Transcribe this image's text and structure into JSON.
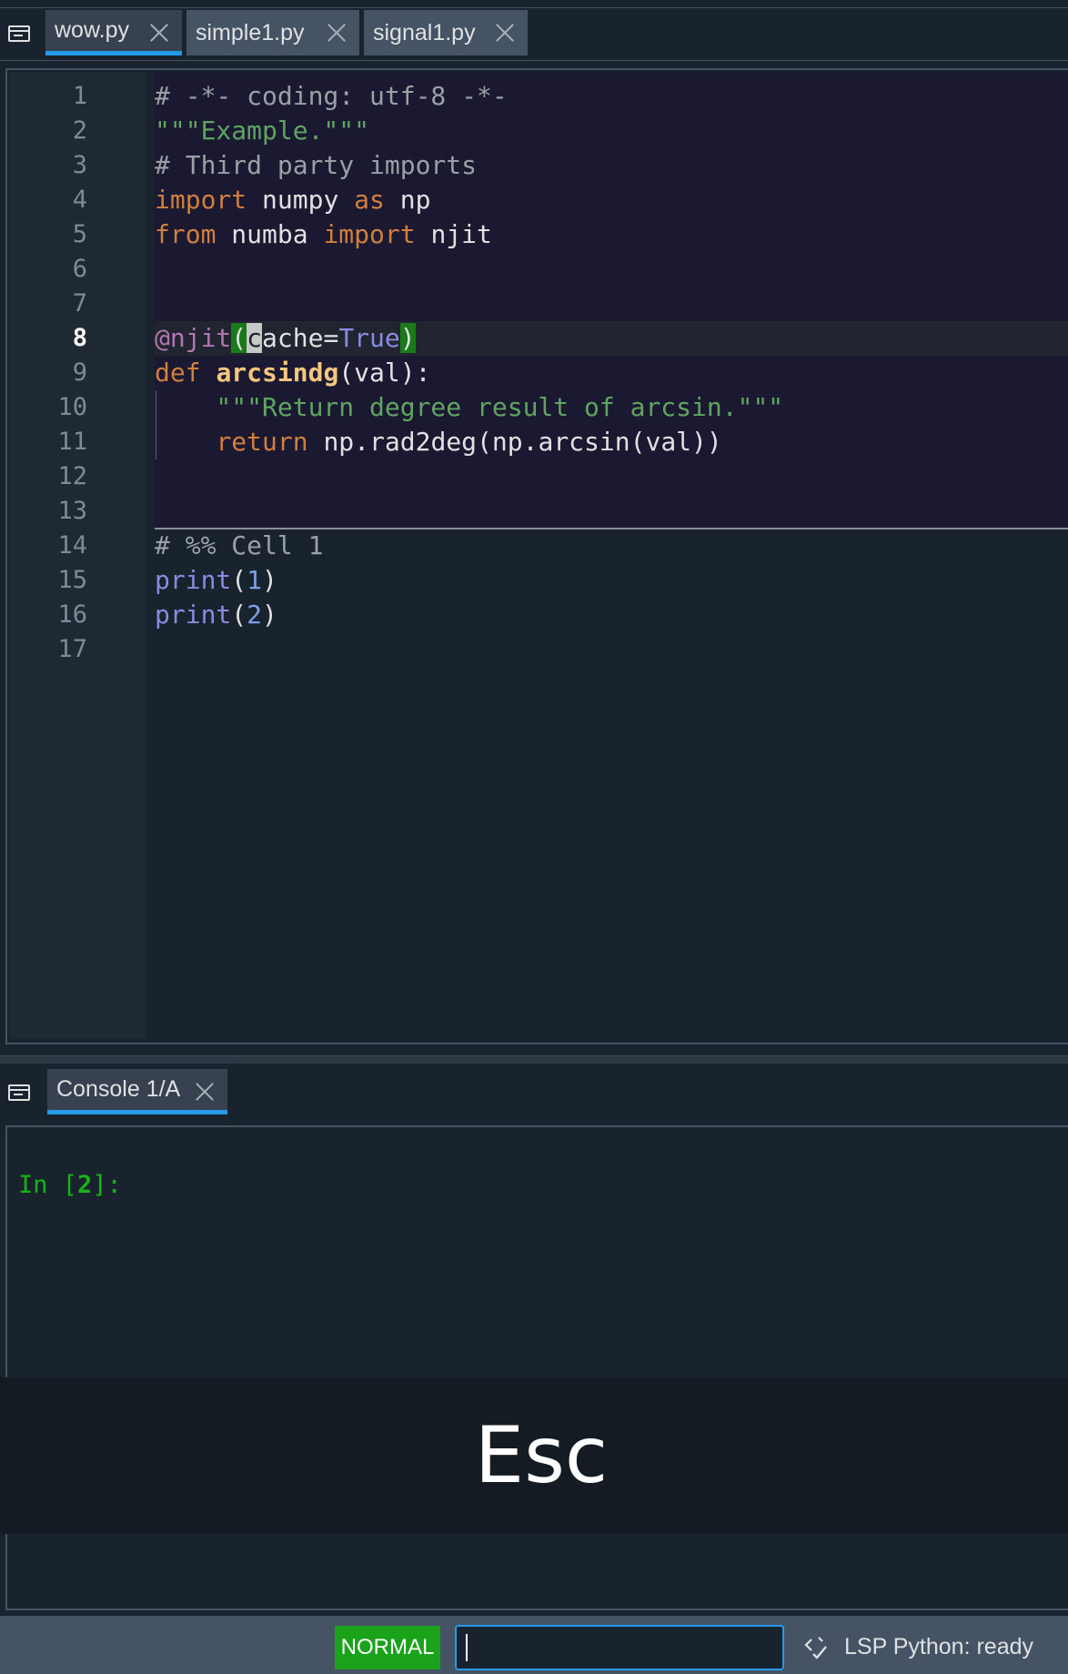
{
  "editor": {
    "tabs": [
      {
        "label": "wow.py",
        "active": true
      },
      {
        "label": "simple1.py",
        "active": false
      },
      {
        "label": "signal1.py",
        "active": false
      }
    ],
    "current_line": 8,
    "line_numbers": [
      "1",
      "2",
      "3",
      "4",
      "5",
      "6",
      "7",
      "8",
      "9",
      "10",
      "11",
      "12",
      "13",
      "14",
      "15",
      "16",
      "17"
    ],
    "code": {
      "l1": "# -*- coding: utf-8 -*-",
      "l2": "\"\"\"Example.\"\"\"",
      "l3": "# Third party imports",
      "l4_kw1": "import",
      "l4_mod": " numpy ",
      "l4_kw2": "as",
      "l4_alias": " np",
      "l5_kw1": "from",
      "l5_mod": " numba ",
      "l5_kw2": "import",
      "l5_name": " njit",
      "l8_dec": "@njit",
      "l8_open": "(",
      "l8_cursor": "c",
      "l8_arg": "ache=",
      "l8_val": "True",
      "l8_close": ")",
      "l9_kw": "def",
      "l9_fn": "arcsindg",
      "l9_sig": "(val):",
      "l10": "    \"\"\"Return degree result of arcsin.\"\"\"",
      "l11_kw": "return",
      "l11_expr": " np.rad2deg(np.arcsin(val))",
      "l14": "# %% Cell 1",
      "l15_fn": "print",
      "l15_open": "(",
      "l15_num": "1",
      "l15_close": ")",
      "l16_fn": "print",
      "l16_open": "(",
      "l16_num": "2",
      "l16_close": ")"
    }
  },
  "console": {
    "tab_label": "Console 1/A",
    "prompt_prefix": "In [",
    "prompt_number": "2",
    "prompt_suffix": "]:"
  },
  "overlay": {
    "key_label": "Esc"
  },
  "statusbar": {
    "mode": "NORMAL",
    "command_value": "",
    "lsp_status": "LSP Python: ready"
  },
  "colors": {
    "accent": "#259ae9",
    "mode_green": "#1aa31a",
    "background": "#19232d",
    "status_bg": "#455364"
  }
}
